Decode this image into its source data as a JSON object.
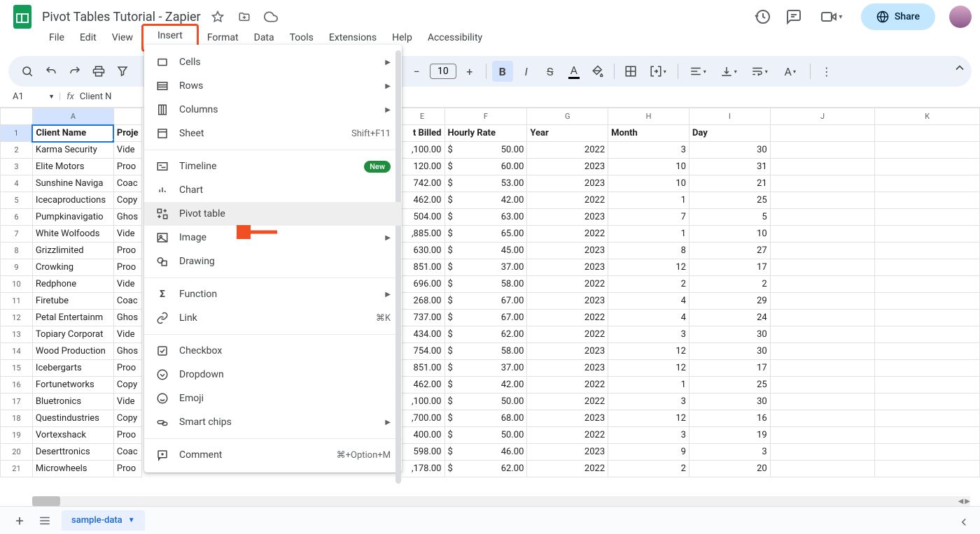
{
  "doc": {
    "title": "Pivot Tables Tutorial - Zapier"
  },
  "menus": {
    "file": "File",
    "edit": "Edit",
    "view": "View",
    "insert": "Insert",
    "format": "Format",
    "data": "Data",
    "tools": "Tools",
    "extensions": "Extensions",
    "help": "Help",
    "accessibility": "Accessibility"
  },
  "toolbar": {
    "font_size": "10"
  },
  "share": {
    "label": "Share"
  },
  "cell_ref": {
    "ref": "A1",
    "fx": "fx",
    "value": "Client N"
  },
  "insert_menu": {
    "cells": "Cells",
    "rows": "Rows",
    "columns": "Columns",
    "sheet": "Sheet",
    "sheet_shortcut": "Shift+F11",
    "timeline": "Timeline",
    "new_badge": "New",
    "chart": "Chart",
    "pivot": "Pivot table",
    "image": "Image",
    "drawing": "Drawing",
    "function": "Function",
    "link": "Link",
    "link_shortcut": "⌘K",
    "checkbox": "Checkbox",
    "dropdown_item": "Dropdown",
    "emoji": "Emoji",
    "smart_chips": "Smart chips",
    "comment": "Comment",
    "comment_shortcut": "⌘+Option+M"
  },
  "columns": {
    "A": "A",
    "E": "E",
    "F": "F",
    "G": "G",
    "H": "H",
    "I": "I",
    "J": "J",
    "K": "K"
  },
  "headers": {
    "client_name": "Client Name",
    "project": "Proje",
    "amount_billed": "t Billed",
    "hourly_rate": "Hourly Rate",
    "year": "Year",
    "month": "Month",
    "day": "Day"
  },
  "rows": [
    {
      "n": "2",
      "client": "Karma Security",
      "proj": "Vide",
      "amt": ",100.00",
      "rate": "50.00",
      "year": "2022",
      "month": "3",
      "day": "30"
    },
    {
      "n": "3",
      "client": "Elite Motors",
      "proj": "Proo",
      "amt": "120.00",
      "rate": "60.00",
      "year": "2023",
      "month": "10",
      "day": "31"
    },
    {
      "n": "4",
      "client": "Sunshine Naviga",
      "proj": "Coac",
      "amt": "742.00",
      "rate": "53.00",
      "year": "2023",
      "month": "10",
      "day": "21"
    },
    {
      "n": "5",
      "client": "Icecaproductions",
      "proj": "Copy",
      "amt": "462.00",
      "rate": "42.00",
      "year": "2022",
      "month": "1",
      "day": "25"
    },
    {
      "n": "6",
      "client": "Pumpkinavigatio",
      "proj": "Ghos",
      "amt": "504.00",
      "rate": "63.00",
      "year": "2023",
      "month": "7",
      "day": "5"
    },
    {
      "n": "7",
      "client": "White Wolfoods",
      "proj": "Vide",
      "amt": ",885.00",
      "rate": "65.00",
      "year": "2022",
      "month": "1",
      "day": "10"
    },
    {
      "n": "8",
      "client": "Grizzlimited",
      "proj": "Proo",
      "amt": "630.00",
      "rate": "45.00",
      "year": "2023",
      "month": "8",
      "day": "27"
    },
    {
      "n": "9",
      "client": "Crowking",
      "proj": "Proo",
      "amt": "851.00",
      "rate": "37.00",
      "year": "2023",
      "month": "12",
      "day": "17"
    },
    {
      "n": "10",
      "client": "Redphone",
      "proj": "Vide",
      "amt": "696.00",
      "rate": "58.00",
      "year": "2022",
      "month": "2",
      "day": "2"
    },
    {
      "n": "11",
      "client": "Firetube",
      "proj": "Coac",
      "amt": "268.00",
      "rate": "67.00",
      "year": "2023",
      "month": "4",
      "day": "29"
    },
    {
      "n": "12",
      "client": "Petal Entertainm",
      "proj": "Ghos",
      "amt": "737.00",
      "rate": "67.00",
      "year": "2022",
      "month": "4",
      "day": "24"
    },
    {
      "n": "13",
      "client": "Topiary Corporat",
      "proj": "Vide",
      "amt": "434.00",
      "rate": "62.00",
      "year": "2022",
      "month": "3",
      "day": "30"
    },
    {
      "n": "14",
      "client": "Wood Production",
      "proj": "Ghos",
      "amt": "754.00",
      "rate": "58.00",
      "year": "2023",
      "month": "12",
      "day": "30"
    },
    {
      "n": "15",
      "client": "Icebergarts",
      "proj": "Proo",
      "amt": "851.00",
      "rate": "37.00",
      "year": "2023",
      "month": "12",
      "day": "17"
    },
    {
      "n": "16",
      "client": "Fortunetworks",
      "proj": "Copy",
      "amt": "462.00",
      "rate": "42.00",
      "year": "2022",
      "month": "1",
      "day": "25"
    },
    {
      "n": "17",
      "client": "Bluetronics",
      "proj": "Vide",
      "amt": ",100.00",
      "rate": "50.00",
      "year": "2022",
      "month": "3",
      "day": "30"
    },
    {
      "n": "18",
      "client": "Questindustries",
      "proj": "Copy",
      "amt": ",700.00",
      "rate": "68.00",
      "year": "2023",
      "month": "12",
      "day": "16"
    },
    {
      "n": "19",
      "client": "Vortexshack",
      "proj": "Proo",
      "amt": "400.00",
      "rate": "50.00",
      "year": "2022",
      "month": "3",
      "day": "19"
    },
    {
      "n": "20",
      "client": "Deserttronics",
      "proj": "Coac",
      "amt": "598.00",
      "rate": "46.00",
      "year": "2023",
      "month": "9",
      "day": "3"
    },
    {
      "n": "21",
      "client": "Microwheels",
      "proj": "Proo",
      "amt": ",178.00",
      "rate": "62.00",
      "year": "2022",
      "month": "2",
      "day": "20"
    }
  ],
  "currency": "$",
  "sheet_tab": {
    "name": "sample-data"
  }
}
